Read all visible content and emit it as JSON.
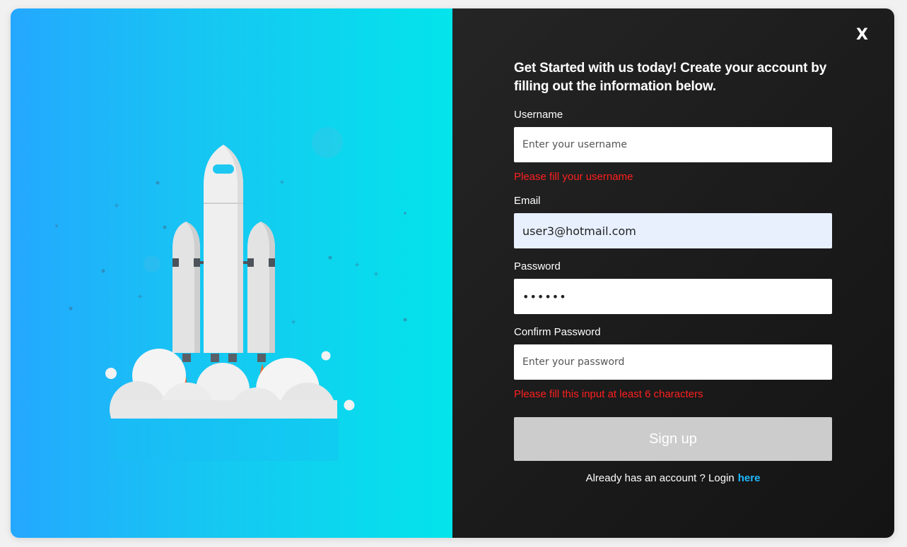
{
  "dialog": {
    "close_label": "X",
    "heading": "Get Started with us today! Create your account by filling out the information below."
  },
  "form": {
    "username": {
      "label": "Username",
      "placeholder": "Enter your username",
      "value": "",
      "error": "Please fill your username"
    },
    "email": {
      "label": "Email",
      "placeholder": "",
      "value": "user3@hotmail.com"
    },
    "password": {
      "label": "Password",
      "value": "••••••"
    },
    "confirm_password": {
      "label": "Confirm Password",
      "placeholder": "Enter your password",
      "value": "",
      "error": "Please fill this input at least 6 characters"
    },
    "submit_label": "Sign up",
    "login_prompt": "Already has an account ? Login",
    "login_link": "here"
  },
  "colors": {
    "gradient_start": "#24a8ff",
    "gradient_end": "#03e4eb",
    "panel_dark": "#1c1c1c",
    "error": "#ff1f1f",
    "link": "#1fb8ff",
    "button_disabled": "#cccccc",
    "autofill_bg": "#e8f0fe"
  },
  "illustration": {
    "icon": "rocket-launch-icon"
  }
}
